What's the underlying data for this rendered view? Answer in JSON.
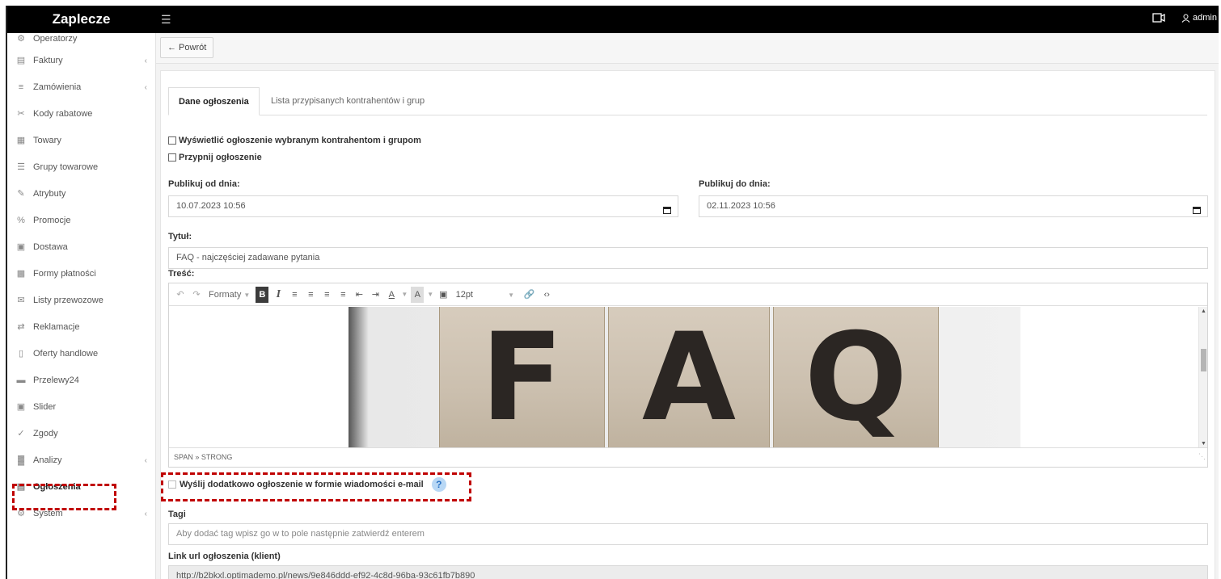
{
  "app": {
    "title": "Zaplecze"
  },
  "topbar": {
    "menu_icon": "hamburger-icon",
    "camera_icon": "video-icon",
    "user_label": "admin"
  },
  "sidebar": {
    "items": [
      {
        "label": "Operatorzy",
        "icon": "operators-icon",
        "has_children": false
      },
      {
        "label": "Faktury",
        "icon": "document-icon",
        "has_children": true
      },
      {
        "label": "Zamówienia",
        "icon": "list-icon",
        "has_children": true
      },
      {
        "label": "Kody rabatowe",
        "icon": "scissors-icon",
        "has_children": false
      },
      {
        "label": "Towary",
        "icon": "boxes-icon",
        "has_children": false
      },
      {
        "label": "Grupy towarowe",
        "icon": "database-icon",
        "has_children": false
      },
      {
        "label": "Atrybuty",
        "icon": "tag-icon",
        "has_children": false
      },
      {
        "label": "Promocje",
        "icon": "percent-icon",
        "has_children": false
      },
      {
        "label": "Dostawa",
        "icon": "truck-icon",
        "has_children": false
      },
      {
        "label": "Formy płatności",
        "icon": "money-icon",
        "has_children": false
      },
      {
        "label": "Listy przewozowe",
        "icon": "envelope-icon",
        "has_children": false
      },
      {
        "label": "Reklamacje",
        "icon": "exchange-icon",
        "has_children": false
      },
      {
        "label": "Oferty handlowe",
        "icon": "file-icon",
        "has_children": false
      },
      {
        "label": "Przelewy24",
        "icon": "card-icon",
        "has_children": false
      },
      {
        "label": "Slider",
        "icon": "image-icon",
        "has_children": false
      },
      {
        "label": "Zgody",
        "icon": "check-icon",
        "has_children": false
      },
      {
        "label": "Analizy",
        "icon": "chart-icon",
        "has_children": true
      },
      {
        "label": "Ogłoszenia",
        "icon": "newspaper-icon",
        "has_children": false,
        "active": true
      },
      {
        "label": "System",
        "icon": "gears-icon",
        "has_children": true
      }
    ]
  },
  "back": {
    "label": "← Powrót"
  },
  "tabs": [
    {
      "label": "Dane ogłoszenia",
      "active": true
    },
    {
      "label": "Lista przypisanych kontrahentów i grup",
      "active": false
    }
  ],
  "form": {
    "show_to_selected_label": "Wyświetlić ogłoszenie wybranym kontrahentom i grupom",
    "pin_label": "Przypnij ogłoszenie",
    "publish_from_label": "Publikuj od dnia:",
    "publish_from_value": "10.07.2023 10:56",
    "publish_to_label": "Publikuj do dnia:",
    "publish_to_value": "02.11.2023 10:56",
    "title_label": "Tytuł:",
    "title_value": "FAQ - najczęściej zadawane pytania",
    "content_label": "Treść:",
    "send_email_label": "Wyślij dodatkowo ogłoszenie w formie wiadomości e-mail",
    "help_symbol": "?",
    "tags_label": "Tagi",
    "tags_placeholder": "Aby dodać tag wpisz go w to pole następnie zatwierdź enterem",
    "link_label": "Link url ogłoszenia (klient)",
    "link_value": "http://b2bkxl.optimademo.pl/news/9e846ddd-ef92-4c8d-96ba-93c61fb7b890"
  },
  "editor": {
    "formats_label": "Formaty",
    "bold_label": "B",
    "italic_label": "I",
    "font_color_label": "A",
    "bg_color_label": "A",
    "font_size": "12pt",
    "statusbar_path": "SPAN » STRONG",
    "image_letters": [
      "F",
      "A",
      "Q"
    ]
  },
  "highlight_color": "#c00000"
}
